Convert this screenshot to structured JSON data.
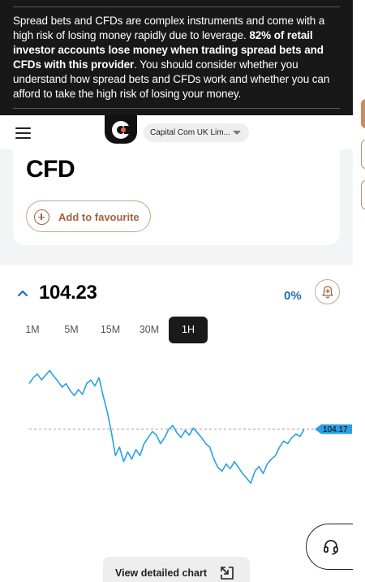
{
  "risk_warning": {
    "text_before": "Spread bets and CFDs are complex instruments and come with a high risk of losing money rapidly due to leverage. ",
    "text_bold": "82% of retail investor accounts lose money when trading spread bets and CFDs with this provider",
    "text_after": ". You should consider whether you understand how spread bets and CFDs work and whether you can afford to take the high risk of losing your money."
  },
  "header": {
    "menu_icon": "hamburger-menu-icon",
    "logo_icon": "capital-com-logo",
    "entity_selector": "Capital Com UK Lim..."
  },
  "instrument": {
    "title": "CFD",
    "favourite_label": "Add to favourite"
  },
  "quote": {
    "price": "104.23",
    "change": "0%",
    "direction_icon": "chevron-up-icon",
    "alert_icon": "bell-plus-icon"
  },
  "timeframes": {
    "items": [
      "1M",
      "5M",
      "15M",
      "30M",
      "1H"
    ],
    "selected": "1H"
  },
  "chart_data": {
    "type": "line",
    "series": [
      {
        "values": [
          104.55,
          104.6,
          104.63,
          104.58,
          104.62,
          104.66,
          104.61,
          104.57,
          104.52,
          104.55,
          104.49,
          104.45,
          104.5,
          104.46,
          104.55,
          104.58,
          104.53,
          104.6,
          104.45,
          104.32,
          104.15,
          103.95,
          104.02,
          103.9,
          103.98,
          103.92,
          104.0,
          103.95,
          104.05,
          104.1,
          104.15,
          104.12,
          104.05,
          104.1,
          104.17,
          104.2,
          104.14,
          104.1,
          104.16,
          104.12,
          104.18,
          104.14,
          104.1,
          104.05,
          104.02,
          103.92,
          103.85,
          103.82,
          103.88,
          103.84,
          103.9,
          103.85,
          103.8,
          103.76,
          103.72,
          103.82,
          103.86,
          103.8,
          103.88,
          103.92,
          103.95,
          104.02,
          104.07,
          104.05,
          104.1,
          104.13,
          104.11,
          104.17
        ]
      }
    ],
    "last_price_label": "104.17",
    "reference_line": 104.17,
    "ylim": [
      103.6,
      104.75
    ],
    "grid": false,
    "line_color": "#2aa0e6"
  },
  "actions": {
    "detailed_chart_label": "View detailed chart",
    "detailed_chart_icon": "expand-arrow-icon",
    "support_icon": "headset-icon"
  },
  "colors": {
    "accent": "#a0643e",
    "banner_bg": "#181818",
    "price_blue": "#1f6fb5"
  }
}
